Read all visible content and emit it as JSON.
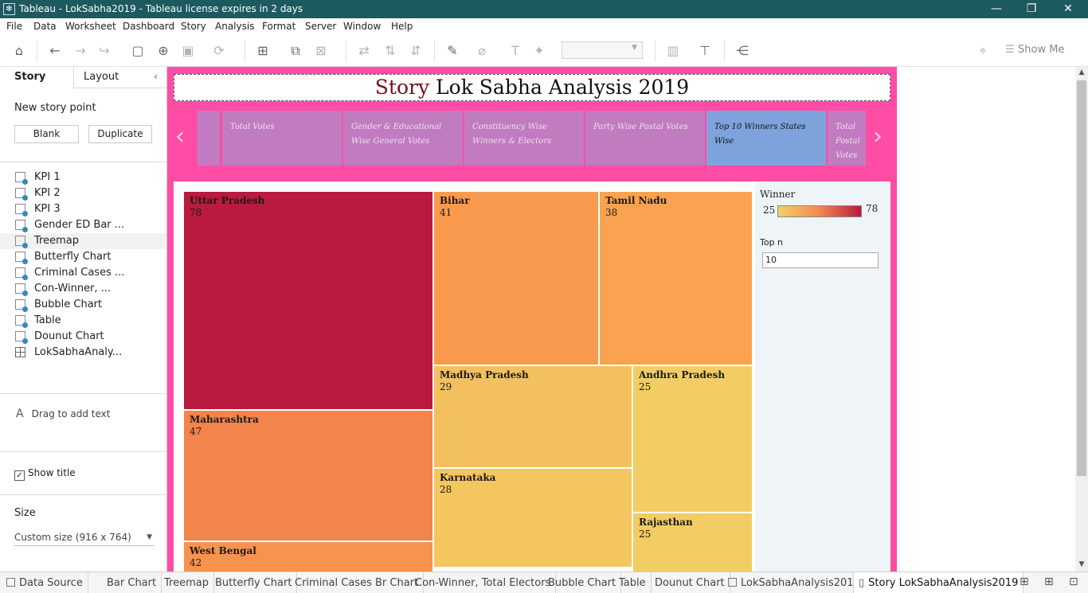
{
  "window": {
    "title": "Tableau - LokSabha2019 - Tableau license expires in 2 days",
    "controls": [
      "—",
      "❐",
      "✕"
    ]
  },
  "menu": [
    "File",
    "Data",
    "Worksheet",
    "Dashboard",
    "Story",
    "Analysis",
    "Format",
    "Server",
    "Window",
    "Help"
  ],
  "toolbar": {
    "show_me": "Show Me",
    "icons": [
      "home-icon",
      "undo-icon",
      "redo-icon",
      "replay-icon",
      "save-icon",
      "new-datasource-icon",
      "pause-icon",
      "refresh-icon",
      "new-sheet-icon",
      "duplicate-icon",
      "clear-icon",
      "swap-icon",
      "sort-asc-icon",
      "sort-desc-icon",
      "highlight-icon",
      "group-icon",
      "label-icon",
      "pin-icon",
      "fit-dropdown",
      "card-icon",
      "presentation-icon",
      "share-icon"
    ]
  },
  "left_pane": {
    "tabs": [
      "Story",
      "Layout"
    ],
    "new_story_point": "New story point",
    "blank_button": "Blank",
    "duplicate_button": "Duplicate",
    "sheets": [
      {
        "label": "KPI 1",
        "type": "worksheet"
      },
      {
        "label": "KPI 2",
        "type": "worksheet"
      },
      {
        "label": "KPI 3",
        "type": "worksheet"
      },
      {
        "label": "Gender ED Bar ...",
        "type": "worksheet"
      },
      {
        "label": "Treemap",
        "type": "worksheet"
      },
      {
        "label": "Butterfly Chart",
        "type": "worksheet"
      },
      {
        "label": "Criminal Cases ...",
        "type": "worksheet"
      },
      {
        "label": "Con-Winner, ...",
        "type": "worksheet"
      },
      {
        "label": "Bubble Chart",
        "type": "worksheet"
      },
      {
        "label": "Table",
        "type": "worksheet"
      },
      {
        "label": "Dounut Chart",
        "type": "worksheet"
      },
      {
        "label": "LokSabhaAnaly...",
        "type": "dashboard"
      }
    ],
    "drag_text": "Drag to add text",
    "show_title": "Show title",
    "size_title": "Size",
    "size_value": "Custom size (916 x 764)"
  },
  "story": {
    "title_first": "Story",
    "title_rest": " Lok Sabha Analysis 2019",
    "points": [
      {
        "text": ""
      },
      {
        "text": "Total Votes"
      },
      {
        "text": "Gender & Educational Wise General Votes"
      },
      {
        "text": "Constituency Wise Winners & Electors"
      },
      {
        "text": "Party Wise Postal Votes"
      },
      {
        "text": "Top 10 Winners States Wise"
      },
      {
        "text": "Total Postal Votes St..."
      }
    ],
    "legend": {
      "title": "Winner",
      "min": "25",
      "max": "78",
      "colors": {
        "low": "#f4d068",
        "mid": "#f08a52",
        "high": "#b8193c"
      }
    },
    "topn": {
      "label": "Top n",
      "value": "10"
    }
  },
  "chart_data": {
    "type": "treemap",
    "measure": "Winner",
    "categories": [
      "Uttar Pradesh",
      "Maharashtra",
      "West Bengal",
      "Bihar",
      "Tamil Nadu",
      "Madhya Pradesh",
      "Karnataka",
      "Andhra Pradesh",
      "Rajasthan"
    ],
    "values": [
      78,
      47,
      42,
      41,
      38,
      29,
      28,
      25,
      25
    ],
    "cell_labels": [
      "78",
      "47",
      "42",
      "41",
      "38",
      "29",
      "28",
      "25",
      "25"
    ],
    "cell_colors": [
      "#b81b3d",
      "#f2844c",
      "#f7934c",
      "#f99a4e",
      "#f9a24f",
      "#f3c05e",
      "#f3c65f",
      "#f2cd63",
      "#f2cd63"
    ]
  },
  "bottom_tabs": [
    "Data Source",
    "Bar Chart",
    "Treemap",
    "Butterfly Chart",
    "Criminal Cases Br Chart",
    "Con-Winner, Total Electors",
    "Bubble Chart",
    "Table",
    "Dounut Chart",
    "LokSabhaAnalysis2019",
    "Story LokSabhaAnalysis2019"
  ]
}
